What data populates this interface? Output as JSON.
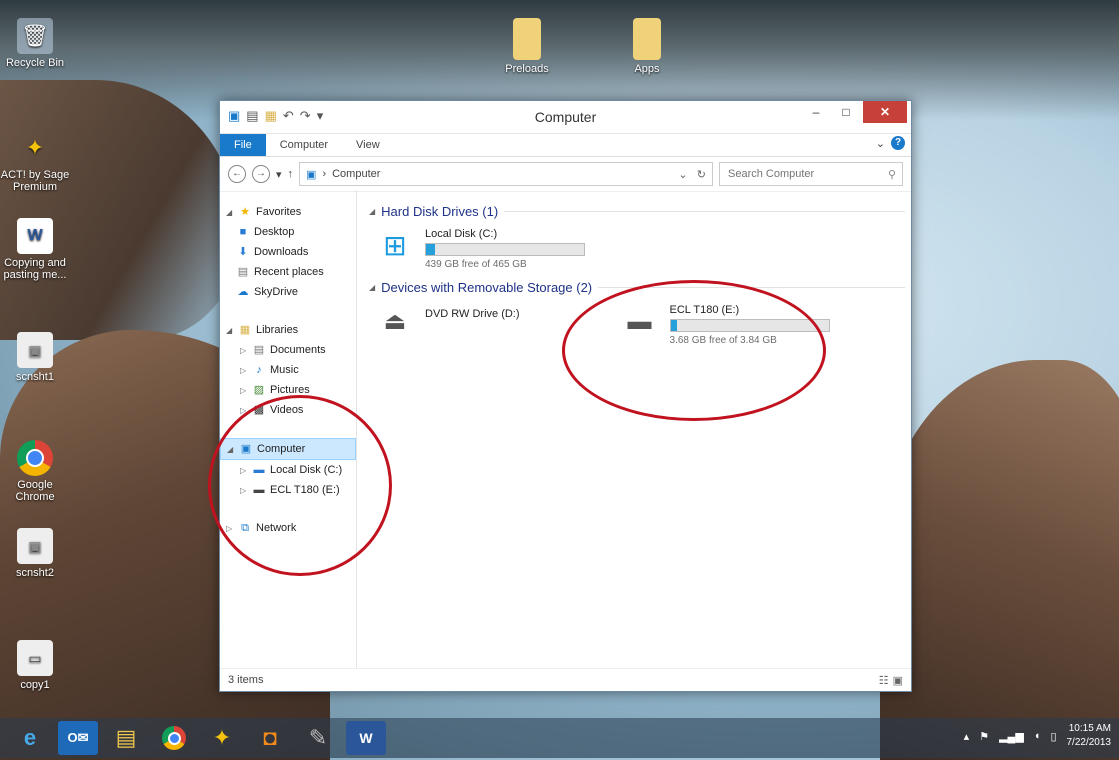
{
  "desktop": {
    "icons": [
      {
        "label": "Recycle Bin",
        "icon": "recycle-bin-icon"
      },
      {
        "label": "ACT! by Sage Premium",
        "icon": "act-icon"
      },
      {
        "label": "Copying and pasting me...",
        "icon": "word-doc-icon"
      },
      {
        "label": "scnsht1",
        "icon": "image-file-icon"
      },
      {
        "label": "Google Chrome",
        "icon": "chrome-icon"
      },
      {
        "label": "scnsht2",
        "icon": "image-file-icon"
      },
      {
        "label": "copy1",
        "icon": "image-file-icon"
      },
      {
        "label": "Preloads",
        "icon": "folder-icon"
      },
      {
        "label": "Apps",
        "icon": "folder-icon"
      }
    ]
  },
  "window": {
    "title": "Computer",
    "ribbon": {
      "file": "File",
      "tabs": [
        "Computer",
        "View"
      ]
    },
    "address": {
      "path": "Computer",
      "search_placeholder": "Search Computer"
    },
    "nav": {
      "favorites": "Favorites",
      "fav_items": [
        "Desktop",
        "Downloads",
        "Recent places",
        "SkyDrive"
      ],
      "libraries": "Libraries",
      "lib_items": [
        "Documents",
        "Music",
        "Pictures",
        "Videos"
      ],
      "computer": "Computer",
      "computer_items": [
        "Local Disk (C:)",
        "ECL T180 (E:)"
      ],
      "network": "Network"
    },
    "groups": {
      "hard": "Hard Disk Drives (1)",
      "removable": "Devices with Removable Storage (2)"
    },
    "drives": {
      "c": {
        "name": "Local Disk (C:)",
        "free": "439 GB free of 465 GB",
        "used_fraction": 0.056
      },
      "dvd": {
        "name": "DVD RW Drive (D:)"
      },
      "e": {
        "name": "ECL T180 (E:)",
        "free": "3.68 GB free of 3.84 GB",
        "used_fraction": 0.042
      }
    },
    "status": {
      "items": "3 items"
    }
  },
  "taskbar": {
    "time": "10:15 AM",
    "date": "7/22/2013"
  },
  "colors": {
    "accent": "#1979ca",
    "annotation": "#c1121f",
    "bar_fill": "#26a0da"
  }
}
